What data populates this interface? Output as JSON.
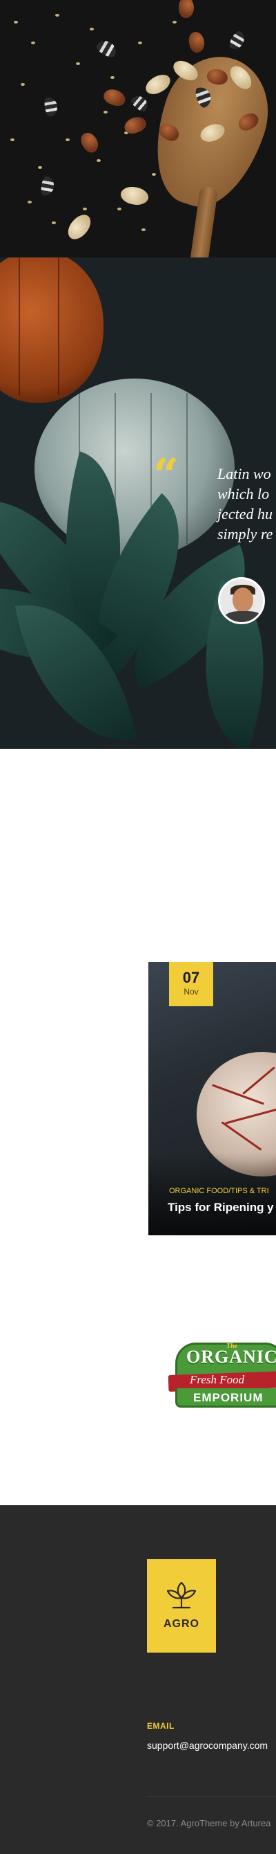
{
  "testimonial": {
    "quote_mark": "“",
    "quote_lines": [
      "Latin wo",
      "which lo",
      "jected hu",
      "simply re"
    ]
  },
  "blog": {
    "date_day": "07",
    "date_month": "Nov",
    "categories": "ORGANIC FOOD/TIPS & TRI",
    "title": "Tips for Ripening y"
  },
  "partner_logo": {
    "the": "The",
    "organic": "ORGANIC",
    "fresh_food": "Fresh Food",
    "emporium": "EMPORIUM"
  },
  "footer": {
    "logo_text": "AGRO",
    "email_label": "EMAIL",
    "email_value": "support@agrocompany.com",
    "copyright": "© 2017. AgroTheme by Arturea"
  },
  "colors": {
    "accent_yellow": "#f2cd3a",
    "footer_bg": "#2a2a2a",
    "testimonial_bg": "#1b2226"
  }
}
